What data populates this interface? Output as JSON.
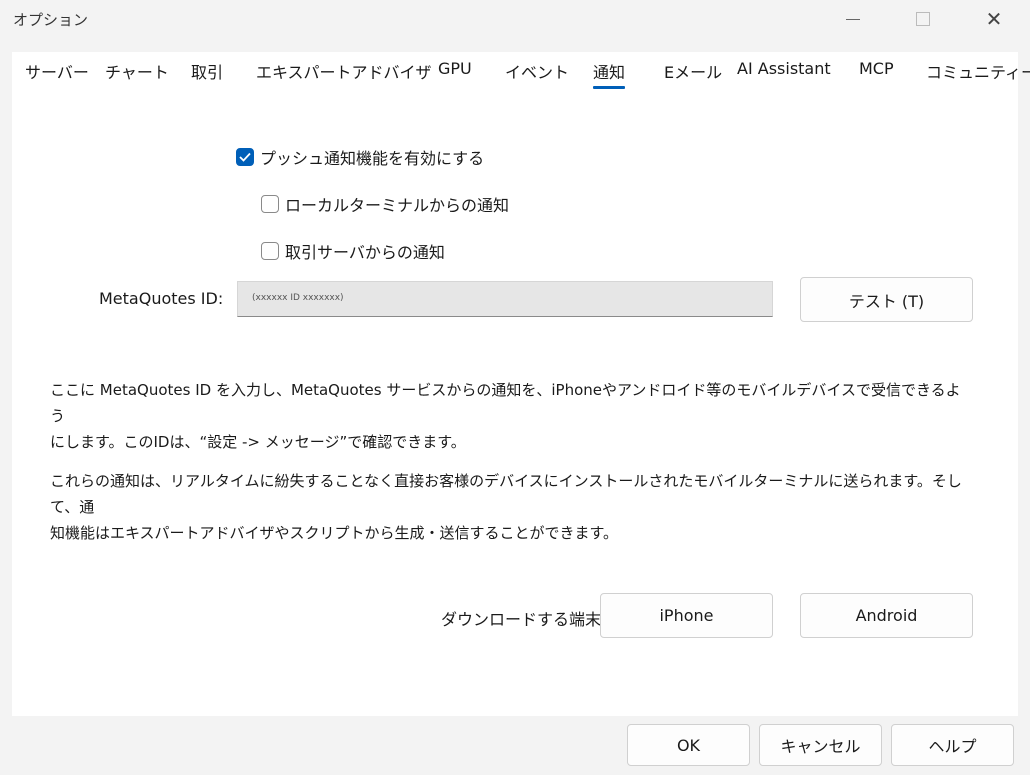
{
  "window": {
    "title": "オプション",
    "minimize_symbol": "—",
    "maximize_symbol": "",
    "close_symbol": "✕"
  },
  "tabs": [
    {
      "label": "サーバー",
      "active": false
    },
    {
      "label": "チャート",
      "active": false
    },
    {
      "label": "取引",
      "active": false
    },
    {
      "label": "エキスパートアドバイザ",
      "active": false
    },
    {
      "label": "GPU",
      "active": false
    },
    {
      "label": "イベント",
      "active": false
    },
    {
      "label": "通知",
      "active": true
    },
    {
      "label": "Eメール",
      "active": false
    },
    {
      "label": "AI Assistant",
      "active": false
    },
    {
      "label": "MCP",
      "active": false
    },
    {
      "label": "コミュニティー",
      "active": false
    }
  ],
  "notifications": {
    "enable_push": {
      "label": "プッシュ通知機能を有効にする",
      "checked": true
    },
    "local_terminal": {
      "label": "ローカルターミナルからの通知",
      "checked": false
    },
    "trade_server": {
      "label": "取引サーバからの通知",
      "checked": false
    },
    "metaquotes_id_label": "MetaQuotes ID:",
    "metaquotes_id_value": "(xxxxxx ID xxxxxxx)",
    "test_button": "テスト (T)",
    "paragraph1_line1": "ここに MetaQuotes ID を入力し、MetaQuotes サービスからの通知を、iPhoneやアンドロイド等のモバイルデバイスで受信できるよう",
    "paragraph1_line2": "にします。このIDは、“設定 -> メッセージ”で確認できます。",
    "paragraph2_line1": "これらの通知は、リアルタイムに紛失することなく直接お客様のデバイスにインストールされたモバイルターミナルに送られます。そして、通",
    "paragraph2_line2": "知機能はエキスパートアドバイザやスクリプトから生成・送信することができます。",
    "download_label": "ダウンロードする端末:",
    "iphone_button": "iPhone",
    "android_button": "Android"
  },
  "footer": {
    "ok": "OK",
    "cancel": "キャンセル",
    "help": "ヘルプ"
  },
  "colors": {
    "accent": "#005fb8",
    "panel": "#ffffff",
    "chrome": "#f3f3f3"
  }
}
